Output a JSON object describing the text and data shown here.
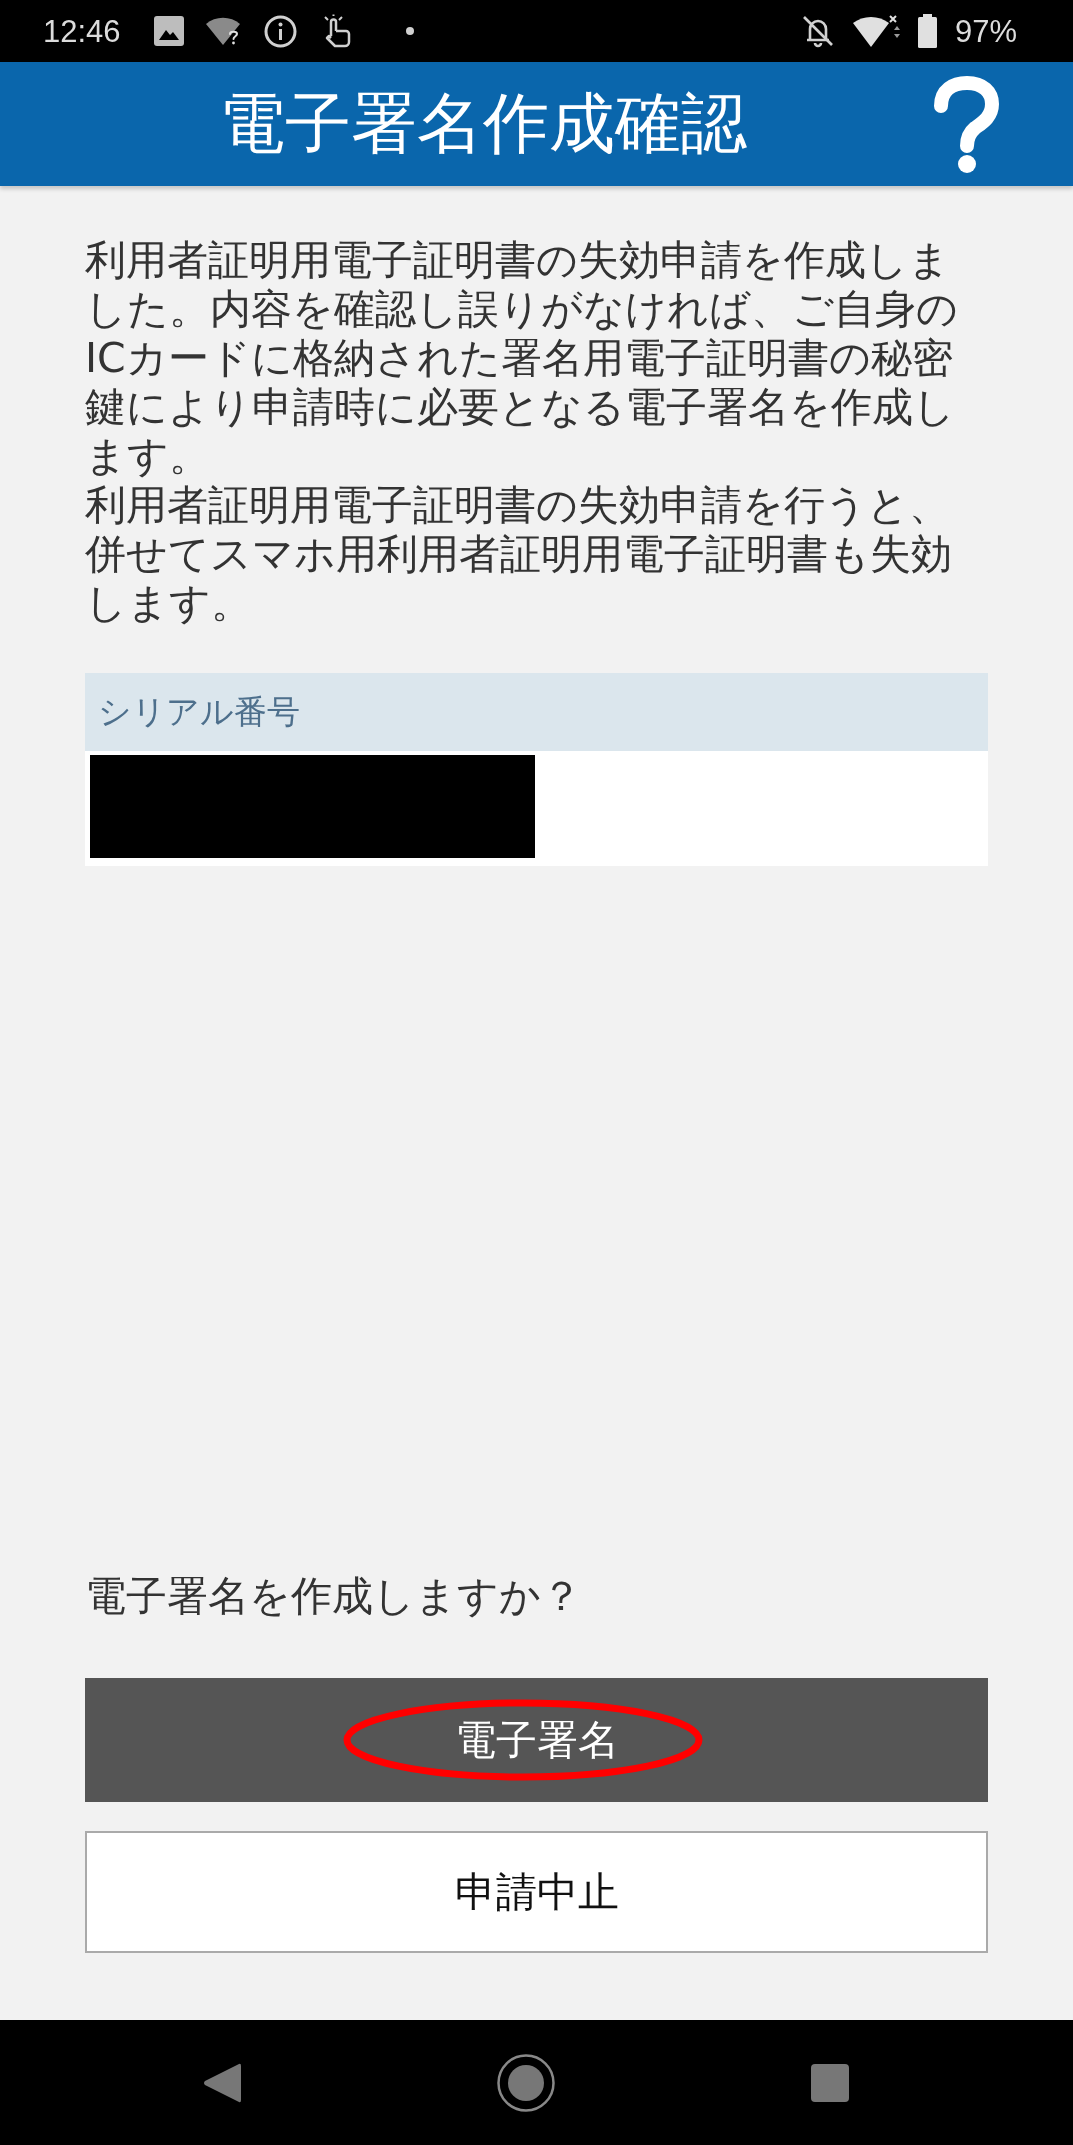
{
  "status_bar": {
    "time": "12:46",
    "battery": "97%"
  },
  "header": {
    "title": "電子署名作成確認"
  },
  "message": [
    "利用者証明用電子証明書の失効申請を作成しました。内容を確認し誤りがなければ、ご自身のICカードに格納された署名用電子証明書の秘密鍵により申請時に必要となる電子署名を作成します。",
    "利用者証明用電子証明書の失効申請を行うと、併せてスマホ用利用者証明用電子証明書も失効します。"
  ],
  "serial": {
    "label": "シリアル番号",
    "redacted": true
  },
  "prompt": "電子署名を作成しますか？",
  "buttons": [
    {
      "label": "電子署名",
      "kind": "primary",
      "circled": true
    },
    {
      "label": "申請中止",
      "kind": "secondary",
      "circled": false
    }
  ]
}
